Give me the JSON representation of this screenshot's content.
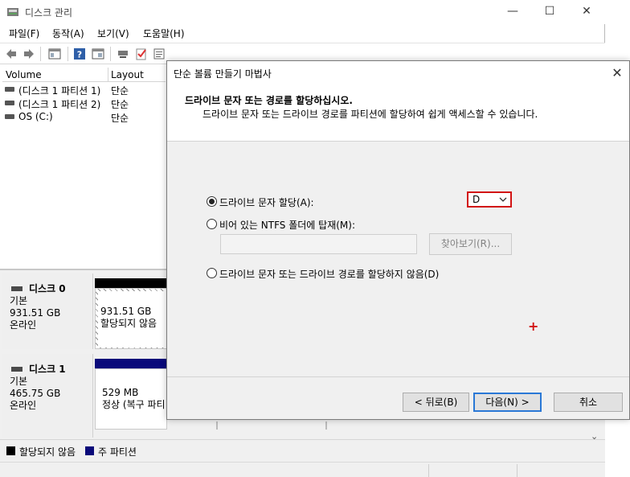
{
  "main_window": {
    "title": "디스크 관리",
    "controls": {
      "minimize": "—",
      "maximize": "☐",
      "close": "✕"
    }
  },
  "menu": [
    "파일(F)",
    "동작(A)",
    "보기(V)",
    "도움말(H)"
  ],
  "toolbar_icons": [
    "back-icon",
    "forward-icon",
    "console-tree-icon",
    "help-icon",
    "show-pane-icon",
    "connect-icon",
    "check-icon",
    "properties-icon"
  ],
  "volume_list": {
    "columns": [
      "Volume",
      "Layout"
    ],
    "rows": [
      {
        "volume": "(디스크 1 파티션 1)",
        "layout": "단순"
      },
      {
        "volume": "(디스크 1 파티션 2)",
        "layout": "단순"
      },
      {
        "volume": "OS (C:)",
        "layout": "단순"
      }
    ]
  },
  "disks": [
    {
      "name": "디스크 0",
      "type": "기본",
      "size": "931.51 GB",
      "status": "온라인",
      "partition": {
        "size": "931.51 GB",
        "status": "할당되지 않음",
        "bar_color": "#000000"
      }
    },
    {
      "name": "디스크 1",
      "type": "기본",
      "size": "465.75 GB",
      "status": "온라인",
      "partition": {
        "size": "529 MB",
        "status": "정상 (복구 파티",
        "bar_color": "#0a0a7a"
      }
    }
  ],
  "legend": [
    {
      "label": "할당되지 않음",
      "color": "#000000"
    },
    {
      "label": "주 파티션",
      "color": "#0a0a7a"
    }
  ],
  "wizard": {
    "title": "단순 볼륨 만들기 마법사",
    "heading": "드라이브 문자 또는 경로를 할당하십시오.",
    "subheading": "드라이브 문자 또는 드라이브 경로를 파티션에 할당하여 쉽게 액세스할 수 있습니다.",
    "options": {
      "assign_letter": "드라이브 문자 할당(A):",
      "mount_folder": "비어 있는 NTFS 폴더에 탑재(M):",
      "no_letter": "드라이브 문자 또는 드라이브 경로를 할당하지 않음(D)"
    },
    "selected_option": "assign_letter",
    "drive_letter": "D",
    "browse_button": "찾아보기(R)...",
    "back_button": "< 뒤로(B)",
    "next_button": "다음(N) >",
    "cancel_button": "취소",
    "close": "✕",
    "cursor_marker": "+",
    "highlight_color": "#d21313"
  }
}
